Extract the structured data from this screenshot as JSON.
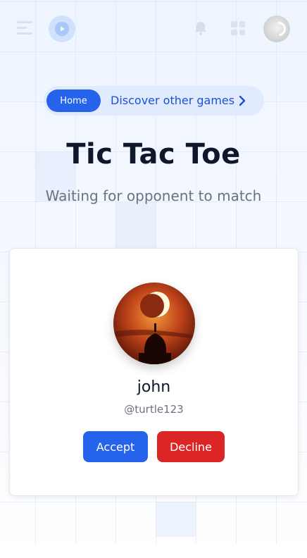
{
  "header": {
    "icons": [
      "menu-icon",
      "play-logo-icon",
      "bell-icon",
      "apps-grid-icon",
      "avatar"
    ]
  },
  "breadcrumb": {
    "home_label": "Home",
    "link_label": "Discover other games",
    "arrow_icon": "chevron-right-icon"
  },
  "page": {
    "title": "Tic Tac Toe",
    "subtitle": "Waiting for opponent to match"
  },
  "opponent": {
    "name": "john",
    "handle": "@turtle123",
    "accept_label": "Accept",
    "decline_label": "Decline"
  },
  "colors": {
    "primary": "#2563eb",
    "danger": "#dc2626",
    "title": "#0f172a",
    "muted": "#6b7280"
  }
}
